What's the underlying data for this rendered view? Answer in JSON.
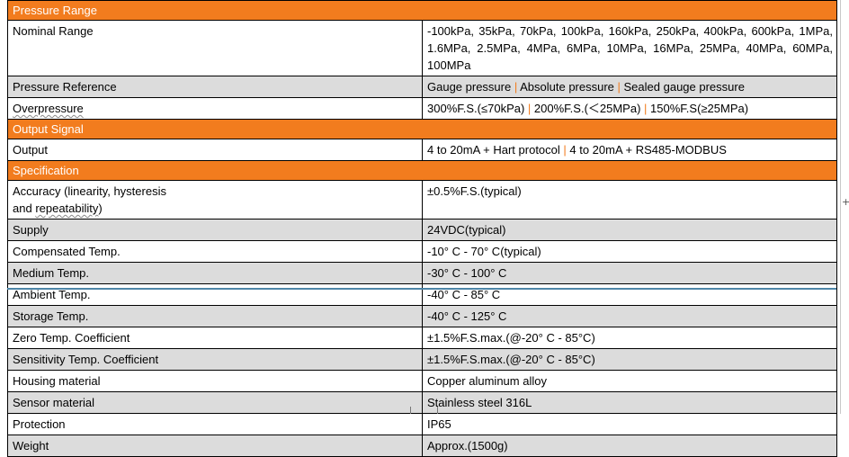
{
  "sections": {
    "pressure_range": "Pressure Range",
    "output_signal": "Output Signal",
    "specification": "Specification"
  },
  "rows": {
    "nominal_range": {
      "label": "Nominal Range",
      "value": "-100kPa, 35kPa, 70kPa, 100kPa, 160kPa, 250kPa, 400kPa, 600kPa, 1MPa, 1.6MPa, 2.5MPa, 4MPa, 6MPa, 10MPa, 16MPa, 25MPa, 40MPa, 60MPa, 100MPa"
    },
    "pressure_reference": {
      "label": "Pressure Reference",
      "values": [
        "Gauge pressure",
        "Absolute pressure",
        "Sealed gauge pressure"
      ]
    },
    "overpressure": {
      "label": "Overpressure",
      "values": [
        "300%F.S.(≤70kPa)",
        "200%F.S.(＜25MPa)",
        "150%F.S(≥25MPa)"
      ]
    },
    "output": {
      "label": "Output",
      "values": [
        "4 to 20mA + Hart protocol",
        "4 to 20mA + RS485-MODBUS"
      ]
    },
    "accuracy": {
      "label_line1": "Accuracy (linearity, hysteresis",
      "label_line2": "and repeatability)",
      "value": "±0.5%F.S.(typical)"
    },
    "supply": {
      "label": "Supply",
      "value": "24VDC(typical)"
    },
    "compensated_temp": {
      "label": "Compensated Temp.",
      "value": "-10° C - 70° C(typical)"
    },
    "medium_temp": {
      "label": "Medium Temp.",
      "value": "-30° C - 100° C"
    },
    "ambient_temp": {
      "label": "Ambient Temp.",
      "value": "-40° C - 85° C"
    },
    "storage_temp": {
      "label": "Storage Temp.",
      "value": "-40° C - 125° C"
    },
    "zero_temp_coefficient": {
      "label": "Zero Temp. Coefficient",
      "value": "±1.5%F.S.max.(@-20° C - 85°C)"
    },
    "sensitivity_temp_coefficient": {
      "label": "Sensitivity Temp. Coefficient",
      "value": "±1.5%F.S.max.(@-20° C - 85°C)"
    },
    "housing_material": {
      "label": "Housing material",
      "value": "Copper aluminum alloy"
    },
    "sensor_material": {
      "label": "Sensor material",
      "value": "Stainless steel 316L"
    },
    "protection": {
      "label": "Protection",
      "value": "IP65"
    },
    "weight": {
      "label": "Weight",
      "value": "Approx.(1500g)"
    }
  },
  "separator": " | ",
  "colors": {
    "section_header_bg": "#f27c1e",
    "section_header_text": "#ffffff",
    "zebra_gray": "#dcdcdc",
    "separator_color": "#f27c1e",
    "cursor_line": "#4e86a8"
  },
  "edge_glyph": "+"
}
